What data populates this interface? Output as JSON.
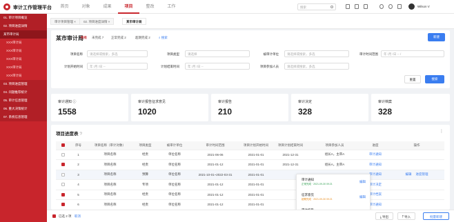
{
  "app": {
    "title": "审计工作管理平台",
    "user": "Wilson V"
  },
  "nav": [
    "首页",
    "对象",
    "成果",
    "项目",
    "整改",
    "工作"
  ],
  "search": {
    "placeholder": "搜索"
  },
  "sidebar": [
    {
      "label": "01. 审计项目概览",
      "type": "grp"
    },
    {
      "label": "02. 项目进度详情",
      "type": "grp"
    },
    {
      "label": "某市审计局",
      "type": "cur"
    },
    {
      "label": "XXX审计局",
      "type": "sub"
    },
    {
      "label": "XXX审计局",
      "type": "sub"
    },
    {
      "label": "XXX审计局",
      "type": "sub"
    },
    {
      "label": "XXX审计局",
      "type": "sub"
    },
    {
      "label": "XXX审计局",
      "type": "sub"
    },
    {
      "label": "03. 项目进度管理",
      "type": "grp"
    },
    {
      "label": "04. 问题推荐统计",
      "type": "grp"
    },
    {
      "label": "05. 审计信息管理",
      "type": "grp"
    },
    {
      "label": "06. 重大决策统计",
      "type": "grp"
    },
    {
      "label": "07. 系统信息管理",
      "type": "grp"
    }
  ],
  "tabs": [
    "审计项目管理 ×",
    "02. 项目进度详情 ×",
    "某市审计局"
  ],
  "main": {
    "title": "某市审计局",
    "filters": [
      "所有",
      "未完成 7",
      "正常完成 2",
      "超期完成 2"
    ],
    "search_link": "搜索",
    "new_button": "新建",
    "reset_button": "重置",
    "query_button": "搜索"
  },
  "form": [
    {
      "label": "项目名称",
      "placeholder": "请选择或搜索，多选"
    },
    {
      "label": "项目类型",
      "placeholder": "请选择"
    },
    {
      "label": "被审计单位",
      "placeholder": "请选择或搜索，多选"
    },
    {
      "label": "审计时间范围",
      "placeholder": "年 /月 /日 -- /"
    },
    {
      "label": "计划开始时间",
      "placeholder": "年 /月 /日 --"
    },
    {
      "label": "计划结束时间",
      "placeholder": "年 /月 /日 --"
    },
    {
      "label": "项目参加人员",
      "placeholder": "请选择或搜索，多选"
    }
  ],
  "stats": [
    {
      "label": "审计通知",
      "value": "1558"
    },
    {
      "label": "审计报告征求意见",
      "value": "1020"
    },
    {
      "label": "审计报告",
      "value": "210"
    },
    {
      "label": "审计决定",
      "value": "328"
    },
    {
      "label": "审计档案",
      "value": "328"
    }
  ],
  "table": {
    "title": "项目进度表",
    "columns": [
      "",
      "序号",
      "项目名称（审计对象）",
      "项目类型",
      "被审计单位",
      "审计时间范围",
      "项目计划开始时间",
      "项目计划结束时间",
      "项目参加人员",
      "进度",
      "操作"
    ],
    "rows": [
      {
        "checked": false,
        "cells": [
          "1",
          "项目名称",
          "经责",
          "单位名称",
          "2021-06-06",
          "2021-01-01",
          "2021-12-31",
          "组长A，主审A",
          "审计通知",
          ""
        ]
      },
      {
        "checked": true,
        "cells": [
          "2",
          "项目名称",
          "经责",
          "单位名称",
          "2021-01-12",
          "2021-01-01",
          "2021-12-31",
          "组长A，主审A",
          "审计通知",
          ""
        ]
      },
      {
        "checked": false,
        "cells": [
          "3",
          "项目名称",
          "预算",
          "单位名称",
          "2021-10-01~2022-03-31",
          "2021-01-01",
          "",
          "",
          "审计通知",
          "编辑"
        ]
      },
      {
        "checked": false,
        "cells": [
          "4",
          "项目名称",
          "专项",
          "单位名称",
          "2021-01-12",
          "2021-01-01",
          "",
          "",
          "审计决定",
          ""
        ]
      },
      {
        "checked": true,
        "cells": [
          "5",
          "项目名称",
          "经责",
          "单位名称",
          "2021-01-12",
          "2021-01-01",
          "",
          "",
          "审计档案",
          ""
        ]
      },
      {
        "checked": true,
        "cells": [
          "6",
          "项目名称",
          "经责",
          "单位名称",
          "2021-01-12",
          "2021-01-01",
          "",
          "",
          "审计通知",
          ""
        ]
      }
    ],
    "row3_extra_action": "进度管理"
  },
  "popover": [
    {
      "title": "审计通知",
      "status": "正常完成 · 2021-09-30 09:21",
      "status_color": "#2e9e4f",
      "edit": "编辑"
    },
    {
      "title": "征求意见",
      "status": "超期完成 · 2021-09-30 09:21",
      "status_color": "#e88a1a",
      "edit": "编辑"
    },
    {
      "title": "审计报告",
      "status": "未完成",
      "status_color": "#c8252c",
      "edit": "编辑"
    }
  ],
  "bottom": {
    "selected": "已选 2 项",
    "cancel": "取消",
    "export": "导出",
    "import": "导入",
    "batch": "批量新建"
  }
}
